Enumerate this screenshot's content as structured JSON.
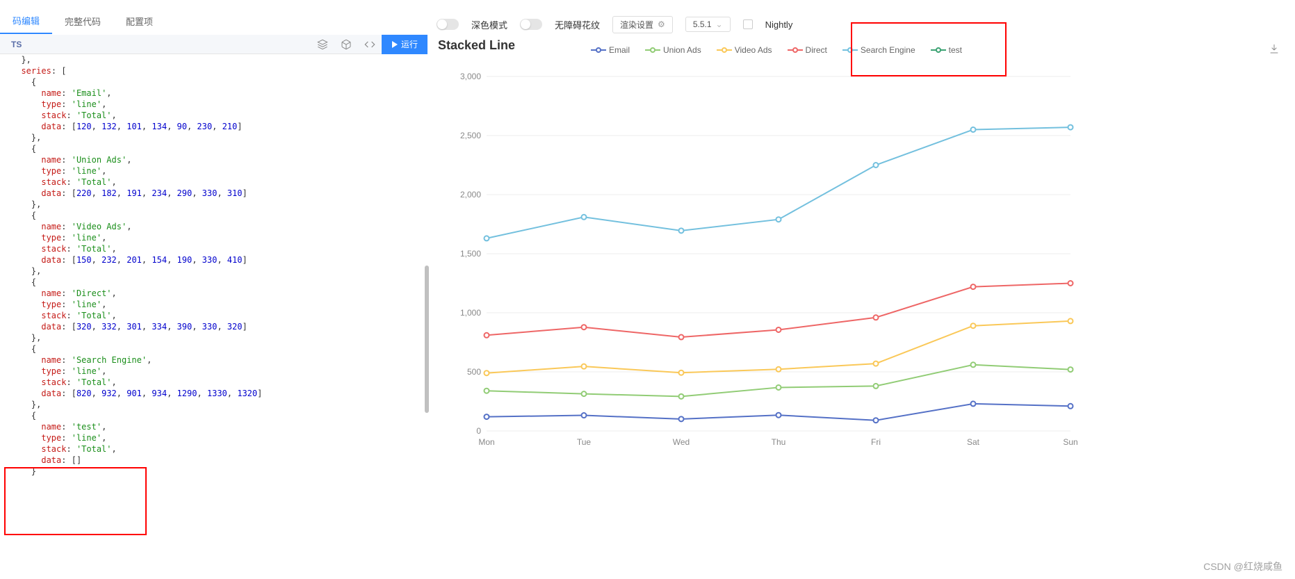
{
  "tabs": {
    "edit": "码编辑",
    "full": "完整代码",
    "config": "配置项"
  },
  "editor": {
    "lang_badge": "TS",
    "run_label": "运行",
    "code": "  },\n  series: [\n    {\n      name: 'Email',\n      type: 'line',\n      stack: 'Total',\n      data: [120, 132, 101, 134, 90, 230, 210]\n    },\n    {\n      name: 'Union Ads',\n      type: 'line',\n      stack: 'Total',\n      data: [220, 182, 191, 234, 290, 330, 310]\n    },\n    {\n      name: 'Video Ads',\n      type: 'line',\n      stack: 'Total',\n      data: [150, 232, 201, 154, 190, 330, 410]\n    },\n    {\n      name: 'Direct',\n      type: 'line',\n      stack: 'Total',\n      data: [320, 332, 301, 334, 390, 330, 320]\n    },\n    {\n      name: 'Search Engine',\n      type: 'line',\n      stack: 'Total',\n      data: [820, 932, 901, 934, 1290, 1330, 1320]\n    },\n    {\n      name: 'test',\n      type: 'line',\n      stack: 'Total',\n      data: []\n    }"
  },
  "toolbar": {
    "dark_mode": "深色模式",
    "accessibility": "无障碍花纹",
    "render_settings": "渲染设置",
    "version": "5.5.1",
    "nightly": "Nightly"
  },
  "chart_data": {
    "type": "line",
    "title": "Stacked Line",
    "categories": [
      "Mon",
      "Tue",
      "Wed",
      "Thu",
      "Fri",
      "Sat",
      "Sun"
    ],
    "ylim": [
      0,
      3000
    ],
    "yticks": [
      0,
      500,
      1000,
      1500,
      2000,
      2500,
      3000
    ],
    "series": [
      {
        "name": "Email",
        "color": "#5470c6",
        "values": [
          120,
          132,
          101,
          134,
          90,
          230,
          210
        ]
      },
      {
        "name": "Union Ads",
        "color": "#91cc75",
        "values": [
          340,
          314,
          292,
          368,
          380,
          560,
          520
        ]
      },
      {
        "name": "Video Ads",
        "color": "#fac858",
        "values": [
          490,
          546,
          493,
          522,
          570,
          890,
          930
        ]
      },
      {
        "name": "Direct",
        "color": "#ee6666",
        "values": [
          810,
          878,
          794,
          856,
          960,
          1220,
          1250
        ]
      },
      {
        "name": "Search Engine",
        "color": "#73c0de",
        "values": [
          1630,
          1810,
          1695,
          1790,
          2250,
          2550,
          2570
        ]
      },
      {
        "name": "test",
        "color": "#3ba272",
        "values": []
      }
    ]
  },
  "watermark": "CSDN @红烧咸鱼"
}
